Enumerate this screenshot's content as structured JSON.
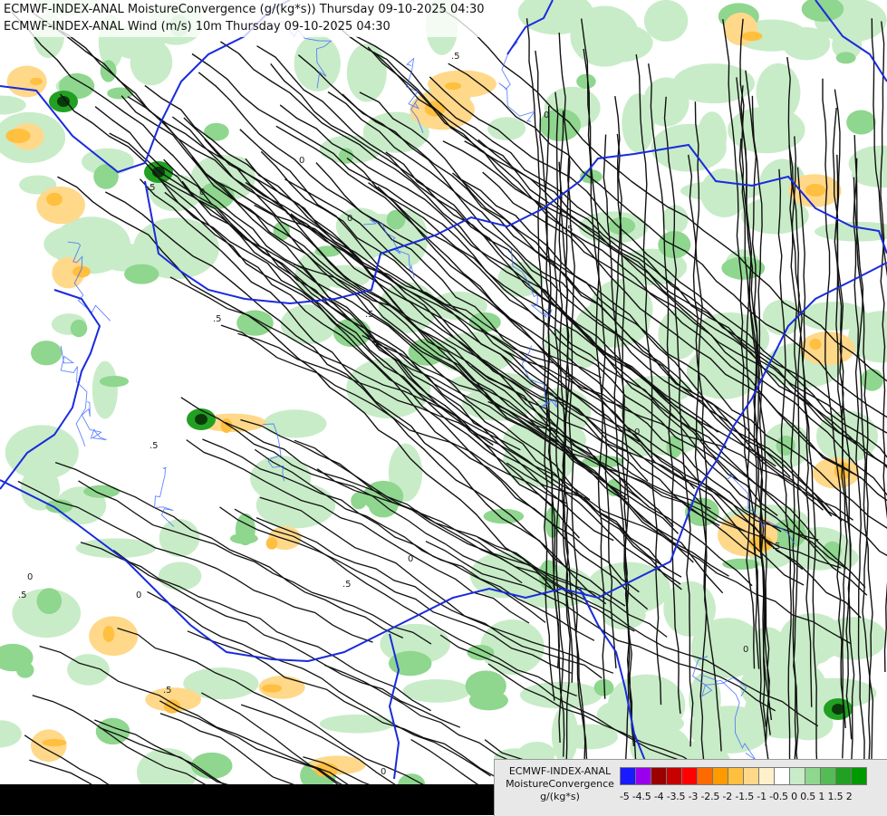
{
  "header": {
    "line1": "ECMWF-INDEX-ANAL MoistureConvergence (g/(kg*s)) Thursday 09-10-2025 04:30",
    "line2": "ECMWF-INDEX-ANAL Wind (m/s) 10m Thursday 09-10-2025 04:30"
  },
  "legend": {
    "title_line1": "ECMWF-INDEX-ANAL",
    "title_line2": "MoistureConvergence",
    "units": "g/(kg*s)",
    "tick_labels": "-5 -4.5 -4 -3.5 -3 -2.5 -2 -1.5 -1 -0.5  0  0.5  1  1.5  2",
    "colors": [
      "#1a1aff",
      "#9900ee",
      "#9b0000",
      "#c80000",
      "#ff0000",
      "#ff6a00",
      "#ff9a00",
      "#ffbf3f",
      "#ffd88a",
      "#fff0cc",
      "#ffffff",
      "#c8ecc8",
      "#8fd68f",
      "#55bb55",
      "#22a022",
      "#009900"
    ]
  },
  "map": {
    "contour_labels": [
      "0",
      "0",
      "0",
      "0",
      "0",
      "0",
      "0",
      "0",
      "0",
      "0",
      ".5",
      ".5",
      ".5",
      ".5",
      ".5",
      ".5",
      ".5",
      ".5",
      ".5",
      ".5"
    ],
    "colors": {
      "border": "#1a2bdd",
      "river": "#3a66ff",
      "stream": "#111111",
      "green_light": "#c8ecc8",
      "green_mid": "#8fd68f",
      "green_dark": "#22a022",
      "orange_light": "#ffd88a",
      "orange_mid": "#ffbf3f"
    }
  }
}
